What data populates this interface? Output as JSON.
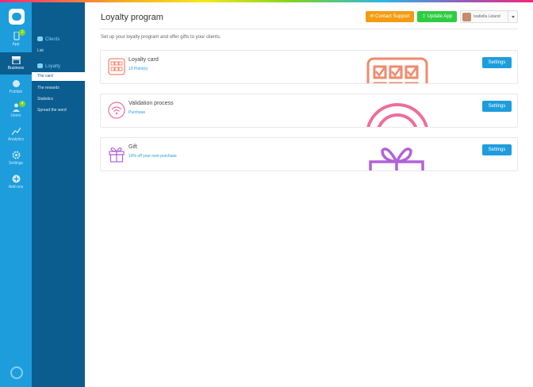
{
  "rail": {
    "items": [
      {
        "label": "App",
        "badge": "2"
      },
      {
        "label": "Business",
        "badge": ""
      },
      {
        "label": "Publish",
        "badge": ""
      },
      {
        "label": "Users",
        "badge": "4"
      },
      {
        "label": "Analytics",
        "badge": ""
      },
      {
        "label": "Settings",
        "badge": ""
      },
      {
        "label": "Add-ons",
        "badge": ""
      }
    ]
  },
  "subnav": {
    "clients_heading": "Clients",
    "list_link": "List",
    "loyalty_heading": "Loyalty",
    "links": [
      "The card",
      "The rewards",
      "Statistics",
      "Spread the word"
    ]
  },
  "header": {
    "title": "Loyalty program",
    "contact_label": "Contact Support",
    "update_label": "Update App",
    "user_name": "Isabella Leland"
  },
  "subtitle": "Set up your loyalty program and offer gifts to your clients.",
  "cards": [
    {
      "title": "Loyalty card",
      "subtitle": "10 Point(s)",
      "button": "Settings"
    },
    {
      "title": "Validation process",
      "subtitle": "Purchase",
      "button": "Settings"
    },
    {
      "title": "Gift",
      "subtitle": "10% off your next purchase",
      "button": "Settings"
    }
  ],
  "colors": {
    "rail": "#1e9ddc",
    "subnav": "#0b5d8f",
    "support": "#f39c12",
    "update": "#2ecc40",
    "card_icon_1": "#f08a6c",
    "card_icon_2": "#f06c9b",
    "card_icon_3": "#b163d8"
  }
}
